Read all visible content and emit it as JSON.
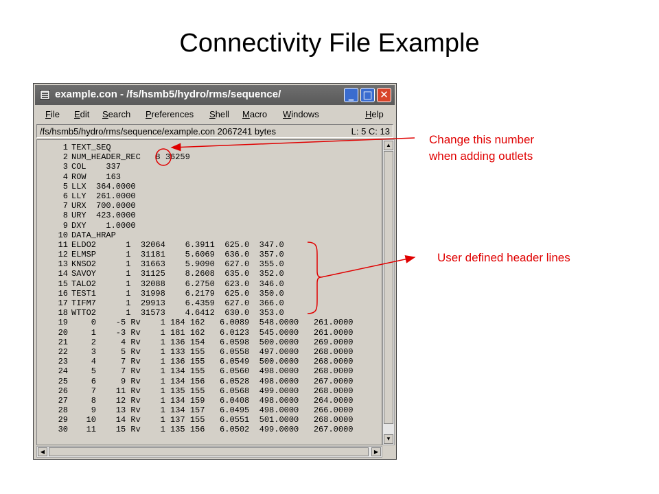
{
  "slide_title": "Connectivity File Example",
  "window": {
    "title": "example.con - /fs/hsmb5/hydro/rms/sequence/",
    "buttons": {
      "minimize": "_",
      "maximize": "□",
      "close": "✕"
    }
  },
  "menu": [
    {
      "label": "File"
    },
    {
      "label": "Edit"
    },
    {
      "label": "Search"
    },
    {
      "label": "Preferences"
    },
    {
      "label": "Shell"
    },
    {
      "label": "Macro"
    },
    {
      "label": "Windows"
    },
    {
      "label": "Help"
    }
  ],
  "status": {
    "path": "/fs/hsmb5/hydro/rms/sequence/example.con 2067241 bytes",
    "position": "L: 5  C: 13"
  },
  "lines": [
    {
      "n": "1",
      "text": "TEXT_SEQ"
    },
    {
      "n": "2",
      "text": "NUM_HEADER_REC   8 36259"
    },
    {
      "n": "3",
      "text": "COL    337"
    },
    {
      "n": "4",
      "text": "ROW    163"
    },
    {
      "n": "5",
      "text": "LLX  364.0000"
    },
    {
      "n": "6",
      "text": "LLY  261.0000"
    },
    {
      "n": "7",
      "text": "URX  700.0000"
    },
    {
      "n": "8",
      "text": "URY  423.0000"
    },
    {
      "n": "9",
      "text": "DXY    1.0000"
    },
    {
      "n": "10",
      "text": "DATA_HRAP"
    },
    {
      "n": "11",
      "text": "ELDO2      1  32064    6.3911  625.0  347.0"
    },
    {
      "n": "12",
      "text": "ELMSP      1  31181    5.6069  636.0  357.0"
    },
    {
      "n": "13",
      "text": "KNSO2      1  31663    5.9090  627.0  355.0"
    },
    {
      "n": "14",
      "text": "SAVOY      1  31125    8.2608  635.0  352.0"
    },
    {
      "n": "15",
      "text": "TALO2      1  32088    6.2750  623.0  346.0"
    },
    {
      "n": "16",
      "text": "TEST1      1  31998    6.2179  625.0  350.0"
    },
    {
      "n": "17",
      "text": "TIFM7      1  29913    6.4359  627.0  366.0"
    },
    {
      "n": "18",
      "text": "WTTO2      1  31573    4.6412  630.0  353.0"
    },
    {
      "n": "19",
      "text": "    0    -5 Rv    1 184 162   6.0089  548.0000   261.0000"
    },
    {
      "n": "20",
      "text": "    1    -3 Rv    1 181 162   6.0123  545.0000   261.0000"
    },
    {
      "n": "21",
      "text": "    2     4 Rv    1 136 154   6.0598  500.0000   269.0000"
    },
    {
      "n": "22",
      "text": "    3     5 Rv    1 133 155   6.0558  497.0000   268.0000"
    },
    {
      "n": "23",
      "text": "    4     7 Rv    1 136 155   6.0549  500.0000   268.0000"
    },
    {
      "n": "24",
      "text": "    5     7 Rv    1 134 155   6.0560  498.0000   268.0000"
    },
    {
      "n": "25",
      "text": "    6     9 Rv    1 134 156   6.0528  498.0000   267.0000"
    },
    {
      "n": "26",
      "text": "    7    11 Rv    1 135 155   6.0568  499.0000   268.0000"
    },
    {
      "n": "27",
      "text": "    8    12 Rv    1 134 159   6.0408  498.0000   264.0000"
    },
    {
      "n": "28",
      "text": "    9    13 Rv    1 134 157   6.0495  498.0000   266.0000"
    },
    {
      "n": "29",
      "text": "   10    14 Rv    1 137 155   6.0551  501.0000   268.0000"
    },
    {
      "n": "30",
      "text": "   11    15 Rv    1 135 156   6.0502  499.0000   267.0000"
    }
  ],
  "annotations": {
    "change_number": [
      "Change this number",
      "when adding outlets"
    ],
    "user_header": "User defined header lines",
    "color": "#e00000"
  }
}
